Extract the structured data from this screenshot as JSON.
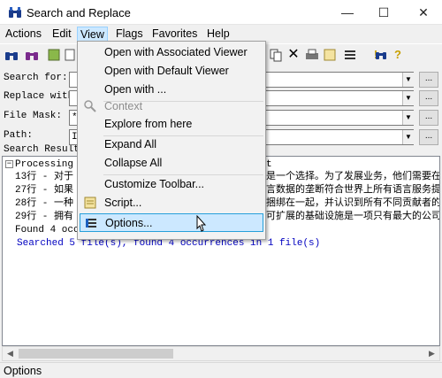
{
  "window": {
    "title": "Search and Replace",
    "minimize": "—",
    "maximize": "☐",
    "close": "✕"
  },
  "menubar": {
    "items": [
      "Actions",
      "Edit",
      "View",
      "Flags",
      "Favorites",
      "Help"
    ]
  },
  "form": {
    "search_label": "Search for:",
    "replace_label": "Replace with:",
    "filemask_label": "File Mask:",
    "path_label": "Path:",
    "search_value": "",
    "replace_value": "",
    "filemask_value": "*",
    "path_value": "I",
    "results_label": "Search Results:",
    "browse": "..."
  },
  "results": {
    "lines": [
      "Processing f",
      "13行 - 对于",
      "27行 - 如果",
      "28行 - 一种",
      "29行 - 拥有",
      "Found 4 occu"
    ],
    "right_fragments": [
      "t",
      "是一个选择。为了发展业务，他们需要在",
      "言数据的垄断符合世界上所有语言服务提",
      "捆绑在一起，并认识到所有不同贡献者的",
      "可扩展的基础设施是一项只有最大的公司"
    ],
    "summary": "Searched 5 file(s), found 4 occurrences in 1 file(s)"
  },
  "status": {
    "text": "Options"
  },
  "view_menu": {
    "items": [
      {
        "label": "Open with Associated Viewer"
      },
      {
        "label": "Open with Default Viewer"
      },
      {
        "label": "Open with ..."
      },
      {
        "label": "Context"
      },
      {
        "label": "Explore from here"
      },
      {
        "label": "Expand All"
      },
      {
        "label": "Collapse All"
      },
      {
        "label": "Customize Toolbar..."
      },
      {
        "label": "Script..."
      },
      {
        "label": "Options..."
      }
    ]
  },
  "colors": {
    "menu_highlight": "#cce8ff",
    "summary_text": "#0000c0"
  },
  "icons": [
    "binoculars-icon",
    "pages-icon",
    "filter-icon",
    "save-icon",
    "cut-icon",
    "print-icon",
    "script-icon",
    "list-icon",
    "info-icon",
    "help-icon"
  ]
}
